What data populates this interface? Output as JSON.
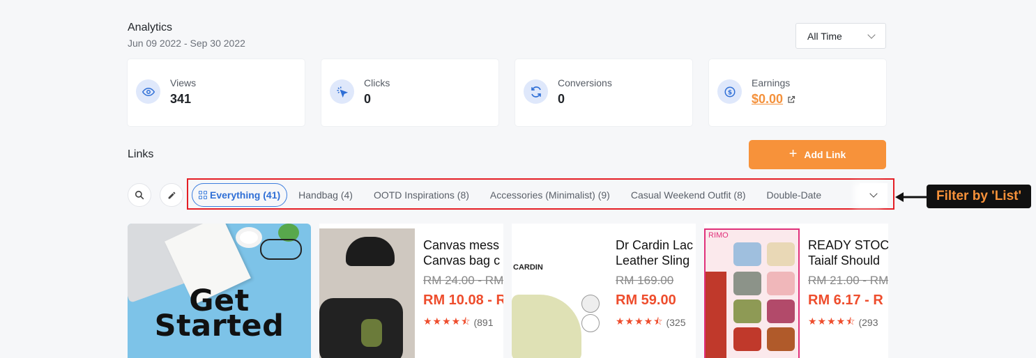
{
  "analytics": {
    "title": "Analytics",
    "date_range": "Jun 09 2022 - Sep 30 2022",
    "time_filter": "All Time"
  },
  "stats": [
    {
      "label": "Views",
      "value": "341",
      "icon": "eye-icon"
    },
    {
      "label": "Clicks",
      "value": "0",
      "icon": "cursor-click-icon"
    },
    {
      "label": "Conversions",
      "value": "0",
      "icon": "refresh-icon"
    },
    {
      "label": "Earnings",
      "value": "$0.00",
      "icon": "dollar-icon"
    }
  ],
  "links": {
    "title": "Links",
    "add_label": "Add Link",
    "add_icon": "plus-icon"
  },
  "filter_tabs": [
    {
      "label": "Everything (41)",
      "active": true
    },
    {
      "label": "Handbag (4)"
    },
    {
      "label": "OOTD Inspirations (8)"
    },
    {
      "label": "Accessories (Minimalist) (9)"
    },
    {
      "label": "Casual Weekend Outfit (8)"
    },
    {
      "label": "Double-Date"
    }
  ],
  "annotation": {
    "label": "Filter by 'List'"
  },
  "hero_card": {
    "text_line1": "Get",
    "text_line2": "Started"
  },
  "products": [
    {
      "name_line1": "Canvas mess",
      "name_line2": "Canvas bag c",
      "old_price": "RM 24.00 - RM",
      "new_price": "RM 10.08 - R",
      "stars": "★★★★⯪",
      "reviews": "(891"
    },
    {
      "name_line1": "Dr Cardin Lac",
      "name_line2": "Leather Sling",
      "old_price": "RM 169.00",
      "new_price": "RM 59.00",
      "stars": "★★★★⯪",
      "reviews": "(325",
      "brand": "CARDIN"
    },
    {
      "name_line1": "READY STOCI",
      "name_line2": "Taialf Should",
      "old_price": "RM 21.00 - RM",
      "new_price": "RM 6.17 - R",
      "stars": "★★★★⯪",
      "reviews": "(293",
      "brand": "RIMO"
    }
  ],
  "colors": {
    "accent": "#f7923a",
    "primary_blue": "#3b7ddd",
    "price_red": "#ee4d2d",
    "highlight_box": "#e41e25"
  }
}
